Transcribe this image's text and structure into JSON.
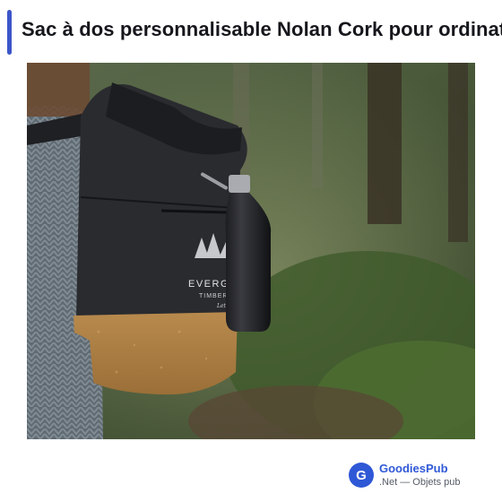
{
  "header": {
    "title": "Sac à dos personnalisable Nolan Cork pour ordinateur",
    "accent_color": "#3b55c9"
  },
  "product_image": {
    "printed_lines": [
      "EVERGREEN",
      "TIMBERCO"
    ],
    "signature_text": "Let's go"
  },
  "brand": {
    "logo_letter": "G",
    "name": "GoodiesPub",
    "tagline": ".Net — Objets pub",
    "color": "#2f58d6"
  }
}
